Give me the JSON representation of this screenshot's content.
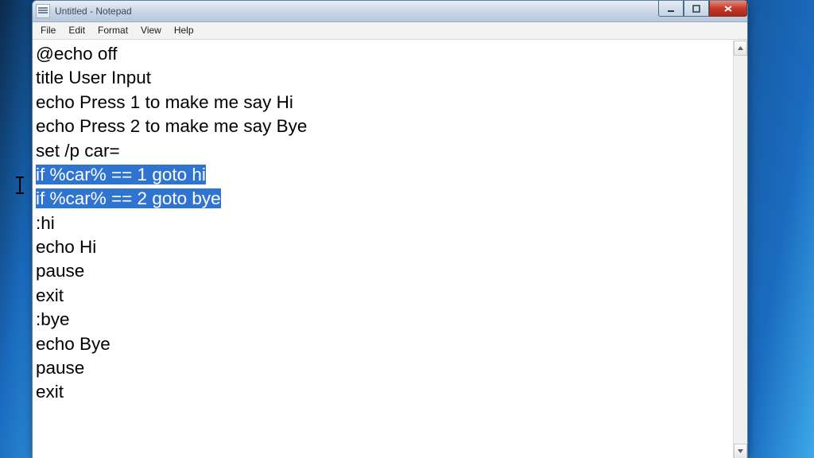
{
  "window": {
    "title": "Untitled - Notepad"
  },
  "menus": {
    "file": "File",
    "edit": "Edit",
    "format": "Format",
    "view": "View",
    "help": "Help"
  },
  "editor": {
    "lines": [
      "@echo off",
      "title User Input",
      "echo Press 1 to make me say Hi",
      "echo Press 2 to make me say Bye",
      "set /p car=",
      "if %car% == 1 goto hi",
      "if %car% == 2 goto bye",
      ":hi",
      "echo Hi",
      "pause",
      "exit",
      ":bye",
      "echo Bye",
      "pause",
      "exit"
    ],
    "selected_line_indexes": [
      5,
      6
    ]
  }
}
